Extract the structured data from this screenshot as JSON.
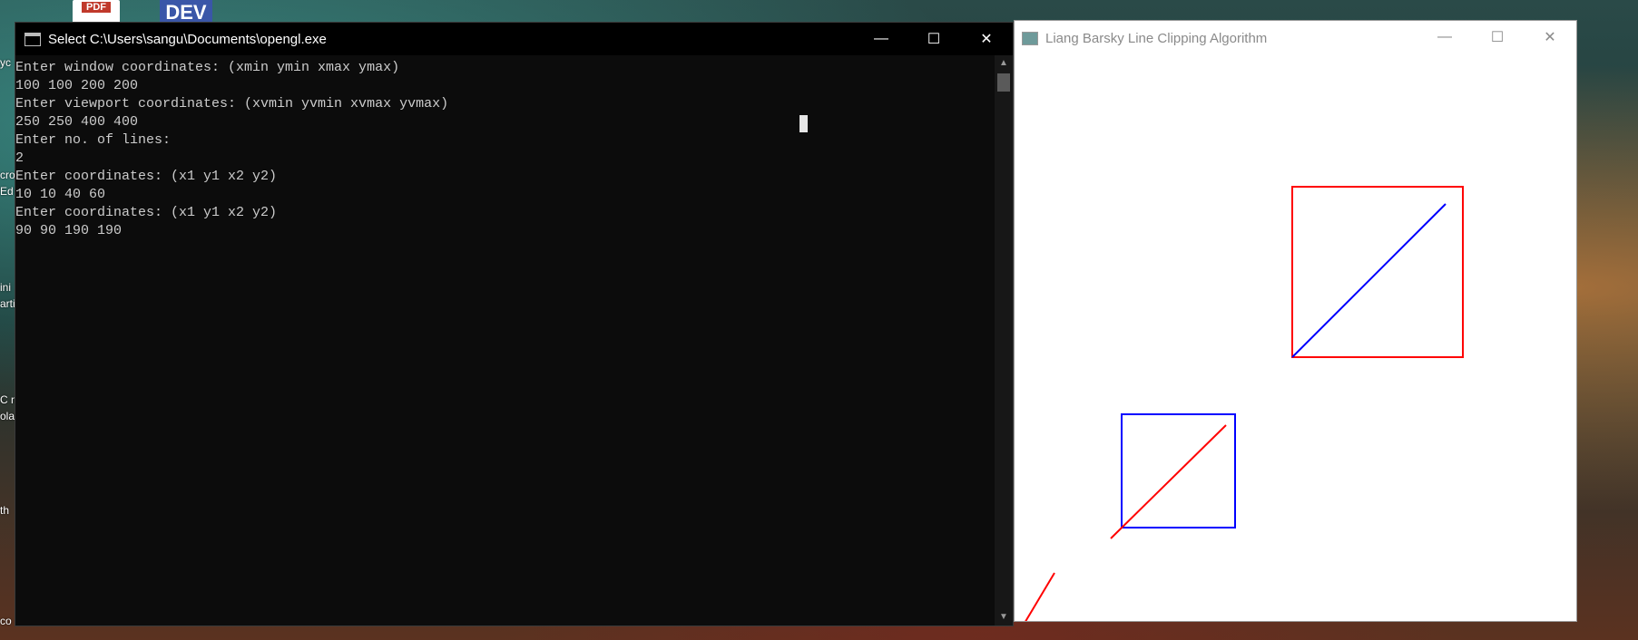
{
  "desktop": {
    "pdf_icon_label": "PDF",
    "dev_icon_label": "DEV",
    "left_icon_labels": [
      "yc",
      "cro",
      "Ed",
      "ini",
      "arti",
      "C n",
      "ola",
      "th",
      "co"
    ]
  },
  "console": {
    "title": "Select C:\\Users\\sangu\\Documents\\opengl.exe",
    "controls": {
      "minimize": "—",
      "maximize": "☐",
      "close": "✕"
    },
    "lines": [
      "Enter window coordinates: (xmin ymin xmax ymax)",
      "100 100 200 200",
      "Enter viewport coordinates: (xvmin yvmin xvmax yvmax)",
      "250 250 400 400",
      "Enter no. of lines:",
      "2",
      "Enter coordinates: (x1 y1 x2 y2)",
      "10 10 40 60",
      "Enter coordinates: (x1 y1 x2 y2)",
      "90 90 190 190"
    ]
  },
  "gl_window": {
    "title": "Liang Barsky Line Clipping Algorithm",
    "controls": {
      "minimize": "—",
      "maximize": "☐",
      "close": "✕"
    },
    "colors": {
      "red": "#ff0000",
      "blue": "#0000ff"
    }
  }
}
